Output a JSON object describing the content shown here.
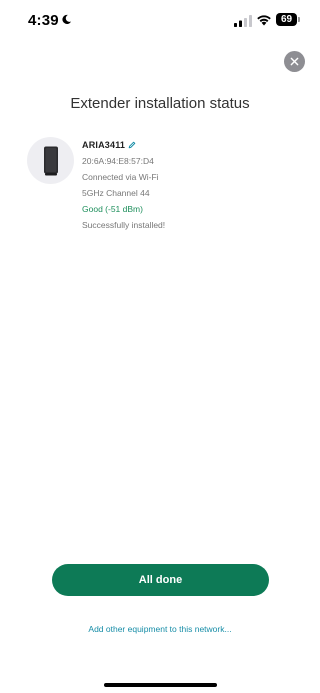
{
  "status_bar": {
    "time": "4:39",
    "battery_level": "69",
    "icons": [
      "moon-icon",
      "signal-icon",
      "wifi-icon",
      "battery-icon"
    ]
  },
  "header": {
    "title": "Extender installation status",
    "close_icon": "close-icon"
  },
  "device": {
    "name": "ARIA3411",
    "edit_icon": "pencil-icon",
    "mac_address": "20:6A:94:E8:57:D4",
    "connection": "Connected via Wi-Fi",
    "band_channel": "5GHz Channel 44",
    "signal": "Good (-51 dBm)",
    "install_status": "Successfully installed!"
  },
  "actions": {
    "primary_label": "All done",
    "secondary_label": "Add other equipment to this network..."
  },
  "colors": {
    "accent": "#0d7a56",
    "signal_good": "#1e8f5c",
    "link": "#178da7"
  }
}
